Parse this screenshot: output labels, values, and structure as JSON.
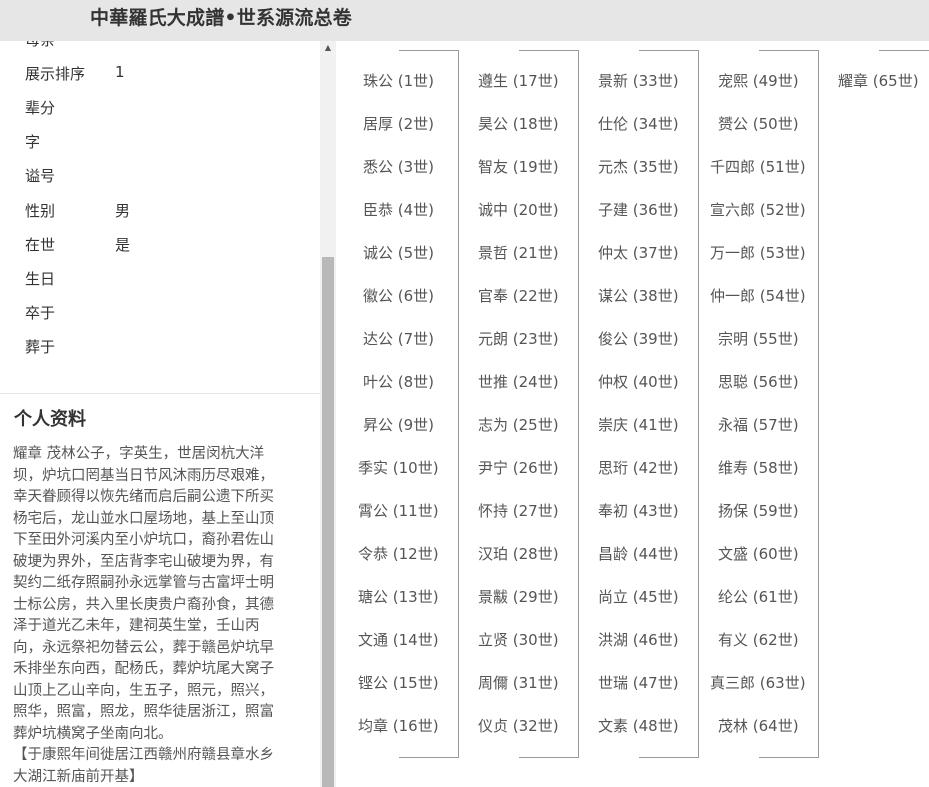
{
  "header": {
    "title": "中華羅氏大成譜•世系源流总卷"
  },
  "fields": [
    {
      "label": "母亲",
      "value": ""
    },
    {
      "label": "展示排序",
      "value": "1"
    },
    {
      "label": "辈分",
      "value": ""
    },
    {
      "label": "字",
      "value": ""
    },
    {
      "label": "谥号",
      "value": ""
    },
    {
      "label": "性别",
      "value": "男"
    },
    {
      "label": "在世",
      "value": "是"
    },
    {
      "label": "生日",
      "value": ""
    },
    {
      "label": "卒于",
      "value": ""
    },
    {
      "label": "葬于",
      "value": ""
    }
  ],
  "profile": {
    "title": "个人资料",
    "lines": [
      "耀章 茂林公子，字英生，世居闵杭大洋",
      "坝，炉坑口罔基当日节风沐雨历尽艰难，",
      "幸天眷顾得以恢先绪而启后嗣公遗下所买",
      "杨宅后，龙山並水口屋场地，基上至山顶",
      "下至田外河溪内至小炉坑口，裔孙君佐山",
      "破埂为界外，至店背李宅山破埂为界，有",
      "契约二纸存照嗣孙永远掌管与古富坪士明",
      "士标公房，共入里长庚贵户裔孙食，其德",
      "泽于道光乙未年，建祠英生堂，壬山丙",
      "向，永远祭祀勿替云公，葬于赣邑炉坑早",
      "禾排坐东向西，配杨氏，葬炉坑尾大窝子",
      "山顶上乙山辛向，生五子，照元，照兴，",
      "照华，照富，照龙，照华徒居浙江，照富",
      "葬炉坑横窝子坐南向北。",
      "【于康熙年间徙居江西赣州府赣县章水乡",
      "大湖江新庙前开基】"
    ]
  },
  "scrollbar": {
    "up_arrow": "▲"
  },
  "tree": {
    "columns": [
      [
        {
          "name": "珠公",
          "gen": "(1世)"
        },
        {
          "name": "居厚",
          "gen": "(2世)"
        },
        {
          "name": "悉公",
          "gen": "(3世)"
        },
        {
          "name": "臣恭",
          "gen": "(4世)"
        },
        {
          "name": "诚公",
          "gen": "(5世)"
        },
        {
          "name": "徽公",
          "gen": "(6世)"
        },
        {
          "name": "达公",
          "gen": "(7世)"
        },
        {
          "name": "叶公",
          "gen": "(8世)"
        },
        {
          "name": "昇公",
          "gen": "(9世)"
        },
        {
          "name": "季实",
          "gen": "(10世)"
        },
        {
          "name": "霄公",
          "gen": "(11世)"
        },
        {
          "name": "令恭",
          "gen": "(12世)"
        },
        {
          "name": "瑭公",
          "gen": "(13世)"
        },
        {
          "name": "文通",
          "gen": "(14世)"
        },
        {
          "name": "铿公",
          "gen": "(15世)"
        },
        {
          "name": "均章",
          "gen": "(16世)"
        }
      ],
      [
        {
          "name": "遵生",
          "gen": "(17世)"
        },
        {
          "name": "昊公",
          "gen": "(18世)"
        },
        {
          "name": "智友",
          "gen": "(19世)"
        },
        {
          "name": "诚中",
          "gen": "(20世)"
        },
        {
          "name": "景哲",
          "gen": "(21世)"
        },
        {
          "name": "官奉",
          "gen": "(22世)"
        },
        {
          "name": "元朗",
          "gen": "(23世)"
        },
        {
          "name": "世推",
          "gen": "(24世)"
        },
        {
          "name": "志为",
          "gen": "(25世)"
        },
        {
          "name": "尹宁",
          "gen": "(26世)"
        },
        {
          "name": "怀持",
          "gen": "(27世)"
        },
        {
          "name": "汉珀",
          "gen": "(28世)"
        },
        {
          "name": "景黻",
          "gen": "(29世)"
        },
        {
          "name": "立贤",
          "gen": "(30世)"
        },
        {
          "name": "周儞",
          "gen": "(31世)"
        },
        {
          "name": "仪贞",
          "gen": "(32世)"
        }
      ],
      [
        {
          "name": "景新",
          "gen": "(33世)"
        },
        {
          "name": "仕伦",
          "gen": "(34世)"
        },
        {
          "name": "元杰",
          "gen": "(35世)"
        },
        {
          "name": "子建",
          "gen": "(36世)"
        },
        {
          "name": "仲太",
          "gen": "(37世)"
        },
        {
          "name": "谋公",
          "gen": "(38世)"
        },
        {
          "name": "俊公",
          "gen": "(39世)"
        },
        {
          "name": "仲权",
          "gen": "(40世)"
        },
        {
          "name": "崇庆",
          "gen": "(41世)"
        },
        {
          "name": "思珩",
          "gen": "(42世)"
        },
        {
          "name": "奉初",
          "gen": "(43世)"
        },
        {
          "name": "昌龄",
          "gen": "(44世)"
        },
        {
          "name": "尚立",
          "gen": "(45世)"
        },
        {
          "name": "洪湖",
          "gen": "(46世)"
        },
        {
          "name": "世瑞",
          "gen": "(47世)"
        },
        {
          "name": "文素",
          "gen": "(48世)"
        }
      ],
      [
        {
          "name": "宠熙",
          "gen": "(49世)"
        },
        {
          "name": "赟公",
          "gen": "(50世)"
        },
        {
          "name": "千四郎",
          "gen": "(51世)"
        },
        {
          "name": "宣六郎",
          "gen": "(52世)"
        },
        {
          "name": "万一郎",
          "gen": "(53世)"
        },
        {
          "name": "仲一郎",
          "gen": "(54世)"
        },
        {
          "name": "宗明",
          "gen": "(55世)"
        },
        {
          "name": "思聪",
          "gen": "(56世)"
        },
        {
          "name": "永福",
          "gen": "(57世)"
        },
        {
          "name": "维寿",
          "gen": "(58世)"
        },
        {
          "name": "扬保",
          "gen": "(59世)"
        },
        {
          "name": "文盛",
          "gen": "(60世)"
        },
        {
          "name": "纶公",
          "gen": "(61世)"
        },
        {
          "name": "有义",
          "gen": "(62世)"
        },
        {
          "name": "真三郎",
          "gen": "(63世)"
        },
        {
          "name": "茂林",
          "gen": "(64世)"
        }
      ],
      [
        {
          "name": "耀章",
          "gen": "(65世)"
        }
      ]
    ]
  }
}
